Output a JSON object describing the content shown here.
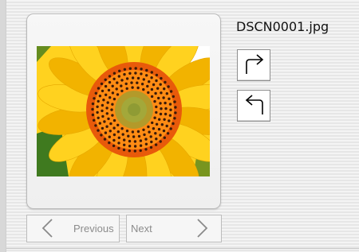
{
  "viewer": {
    "file_name": "DSCN0001.jpg",
    "photo": {
      "subject": "sunflower",
      "colors": {
        "background": "#ffffff",
        "leaves": "#3f7a1f",
        "petals": "#ffd21f",
        "petal_shadow": "#f2b300",
        "disk_outer": "#e85a0a",
        "disk_mid": "#ff8c14",
        "disk_center": "#a3a83a",
        "seeds": "#3a1a08"
      }
    }
  },
  "toolbar": {
    "rotate_right_icon": "rotate-clockwise-icon",
    "rotate_left_icon": "rotate-counterclockwise-icon"
  },
  "navigation": {
    "previous_label": "Previous",
    "next_label": "Next",
    "previous_icon": "chevron-left-icon",
    "next_icon": "chevron-right-icon",
    "disabled_text_color": "#8c8c8c"
  }
}
